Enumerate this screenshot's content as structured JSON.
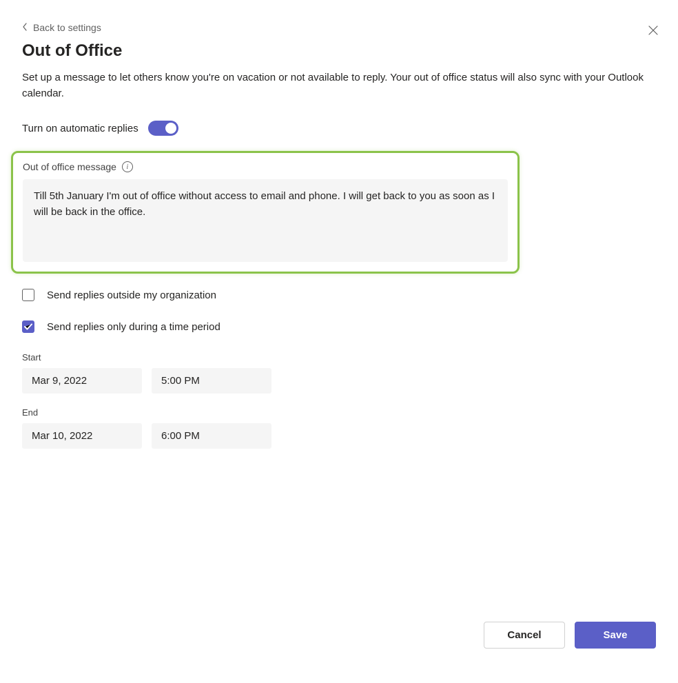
{
  "header": {
    "back_label": "Back to settings",
    "title": "Out of Office",
    "description": "Set up a message to let others know you're on vacation or not available to reply. Your out of office status will also sync with your Outlook calendar."
  },
  "toggle": {
    "label": "Turn on automatic replies",
    "enabled": true
  },
  "message_section": {
    "label": "Out of office message",
    "value": "Till 5th January I'm out of office without access to email and phone. I will get back to you as soon as I will be back in the office."
  },
  "options": {
    "send_outside": {
      "label": "Send replies outside my organization",
      "checked": false
    },
    "time_period": {
      "label": "Send replies only during a time period",
      "checked": true
    }
  },
  "schedule": {
    "start_label": "Start",
    "start_date": "Mar 9, 2022",
    "start_time": "5:00 PM",
    "end_label": "End",
    "end_date": "Mar 10, 2022",
    "end_time": "6:00 PM"
  },
  "footer": {
    "cancel": "Cancel",
    "save": "Save"
  }
}
